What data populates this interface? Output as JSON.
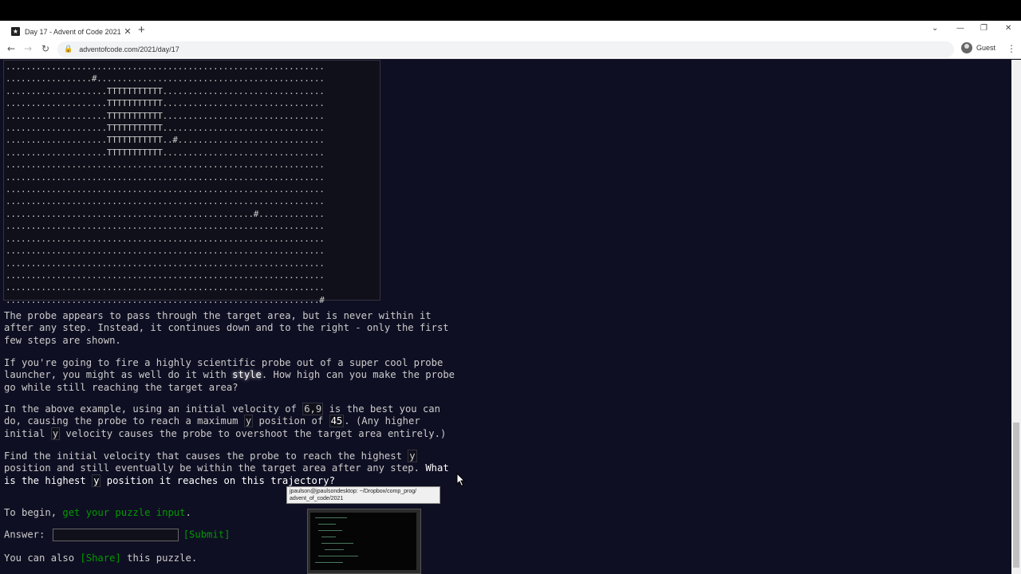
{
  "browser": {
    "tab_title": "Day 17 - Advent of Code 2021",
    "favicon": "★",
    "url": "adventofcode.com/2021/day/17",
    "profile_label": "Guest",
    "new_tab_glyph": "+",
    "close_glyph": "✕"
  },
  "diagram_lines": [
    "...............................................................",
    ".................#.............................................",
    "....................TTTTTTTTTTT................................",
    "....................TTTTTTTTTTT................................",
    "....................TTTTTTTTTTT................................",
    "....................TTTTTTTTTTT................................",
    "....................TTTTTTTTTTT..#.............................",
    "....................TTTTTTTTTTT................................",
    "...............................................................",
    "...............................................................",
    "...............................................................",
    "...............................................................",
    ".................................................#.............",
    "...............................................................",
    "...............................................................",
    "...............................................................",
    "...............................................................",
    "...............................................................",
    "...............................................................",
    "..............................................................#"
  ],
  "para1": {
    "text": "The probe appears to pass through the target area, but is never within it after any step. Instead, it continues down and to the right - only the first few steps are shown."
  },
  "para2": {
    "before": "If you're going to fire a highly scientific probe out of a super cool probe launcher, you might as well do it with ",
    "em": "style",
    "after": ". How high can you make the probe go while still reaching the target area?"
  },
  "para3": {
    "t1": "In the above example, using an initial velocity of ",
    "c1": "6,9",
    "t2": " is the best you can do, causing the probe to reach a maximum ",
    "c2": "y",
    "t3": " position of ",
    "c3": "45",
    "t4": ". (Any higher initial ",
    "c4": "y",
    "t5": " velocity causes the probe to overshoot the target area entirely.)"
  },
  "para4": {
    "t1": "Find the initial velocity that causes the probe to reach the highest ",
    "c1": "y",
    "t2": " position and still eventually be within the target area after any step. ",
    "q1": "What is the highest ",
    "qc": "y",
    "q2": " position it reaches on this trajectory?"
  },
  "begin": {
    "prefix": "To begin, ",
    "link": "get your puzzle input",
    "suffix": "."
  },
  "answer": {
    "label": "Answer: ",
    "submit": "[Submit]"
  },
  "share": {
    "prefix": "You can also ",
    "link": "[Share]",
    "suffix": " this puzzle."
  },
  "tooltip": {
    "line1": "jpaulson@jpaulsondesktop: ~/Dropbox/comp_prog/",
    "line2": "advent_of_code/2021"
  },
  "colors": {
    "background": "#0f0f23",
    "text": "#cccccc",
    "link": "#009900",
    "highlight": "#ffffff"
  }
}
